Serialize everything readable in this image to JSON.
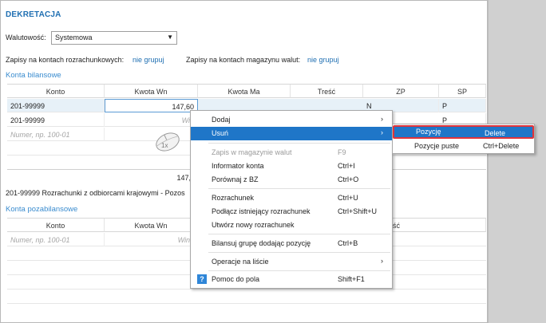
{
  "title": "DEKRETACJA",
  "currency": {
    "label": "Walutowość:",
    "value": "Systemowa"
  },
  "entries": {
    "settlement_label": "Zapisy na kontach rozrachunkowych:",
    "settlement_link": "nie grupuj",
    "currency_label": "Zapisy na kontach magazynu walut:",
    "currency_link": "nie grupuj"
  },
  "balance_section": {
    "title": "Konta bilansowe",
    "columns": [
      "Konto",
      "Kwota Wn",
      "Kwota Ma",
      "Treść",
      "ZP",
      "SP"
    ],
    "rows": [
      {
        "konto": "201-99999",
        "wn": "147,60",
        "ma": "",
        "tresc": "",
        "zp": "N",
        "sp": "P"
      },
      {
        "konto": "201-99999",
        "wn": "Wie",
        "ma": "",
        "tresc": "",
        "zp": "",
        "sp": "P"
      },
      {
        "konto": "Numer, np. 100-01",
        "wn": "",
        "ma": "",
        "tresc": "",
        "zp": "",
        "sp": ""
      }
    ],
    "total_wn": "147,6",
    "summary": "201-99999  Rozrachunki z odbiorcami krajowymi - Pozos"
  },
  "offbalance_section": {
    "title": "Konta pozabilansowe",
    "columns": [
      "Konto",
      "Kwota Wn",
      "",
      "ść"
    ],
    "placeholder_konto": "Numer, np. 100-01",
    "placeholder_wn": "Wine"
  },
  "context_menu": [
    {
      "label": "Dodaj",
      "shortcut": "",
      "submenu": true,
      "disabled": false
    },
    {
      "label": "Usuń",
      "shortcut": "",
      "submenu": true,
      "disabled": false,
      "highlighted": true
    },
    {
      "label": "Zapis w magazynie walut",
      "shortcut": "F9",
      "submenu": false,
      "disabled": true
    },
    {
      "label": "Informator konta",
      "shortcut": "Ctrl+I",
      "submenu": false,
      "disabled": false
    },
    {
      "label": "Porównaj z BZ",
      "shortcut": "Ctrl+O",
      "submenu": false,
      "disabled": false
    },
    {
      "label": "Rozrachunek",
      "shortcut": "Ctrl+U",
      "submenu": false,
      "disabled": false
    },
    {
      "label": "Podłącz istniejący rozrachunek",
      "shortcut": "Ctrl+Shift+U",
      "submenu": false,
      "disabled": false
    },
    {
      "label": "Utwórz nowy rozrachunek",
      "shortcut": "",
      "submenu": false,
      "disabled": false
    },
    {
      "label": "Bilansuj grupę dodając pozycję",
      "shortcut": "Ctrl+B",
      "submenu": false,
      "disabled": false
    },
    {
      "label": "Operacje na liście",
      "shortcut": "",
      "submenu": true,
      "disabled": false
    },
    {
      "label": "Pomoc do pola",
      "shortcut": "Shift+F1",
      "submenu": false,
      "disabled": false,
      "icon": "help-icon"
    }
  ],
  "submenu": [
    {
      "label": "Pozycję",
      "shortcut": "Delete",
      "highlighted": true
    },
    {
      "label": "Pozycje puste",
      "shortcut": "Ctrl+Delete"
    }
  ],
  "mouse_hint": "1x",
  "colors": {
    "accent": "#1f76c8",
    "title": "#1f6fb2",
    "highlight_border": "#e0343a"
  }
}
